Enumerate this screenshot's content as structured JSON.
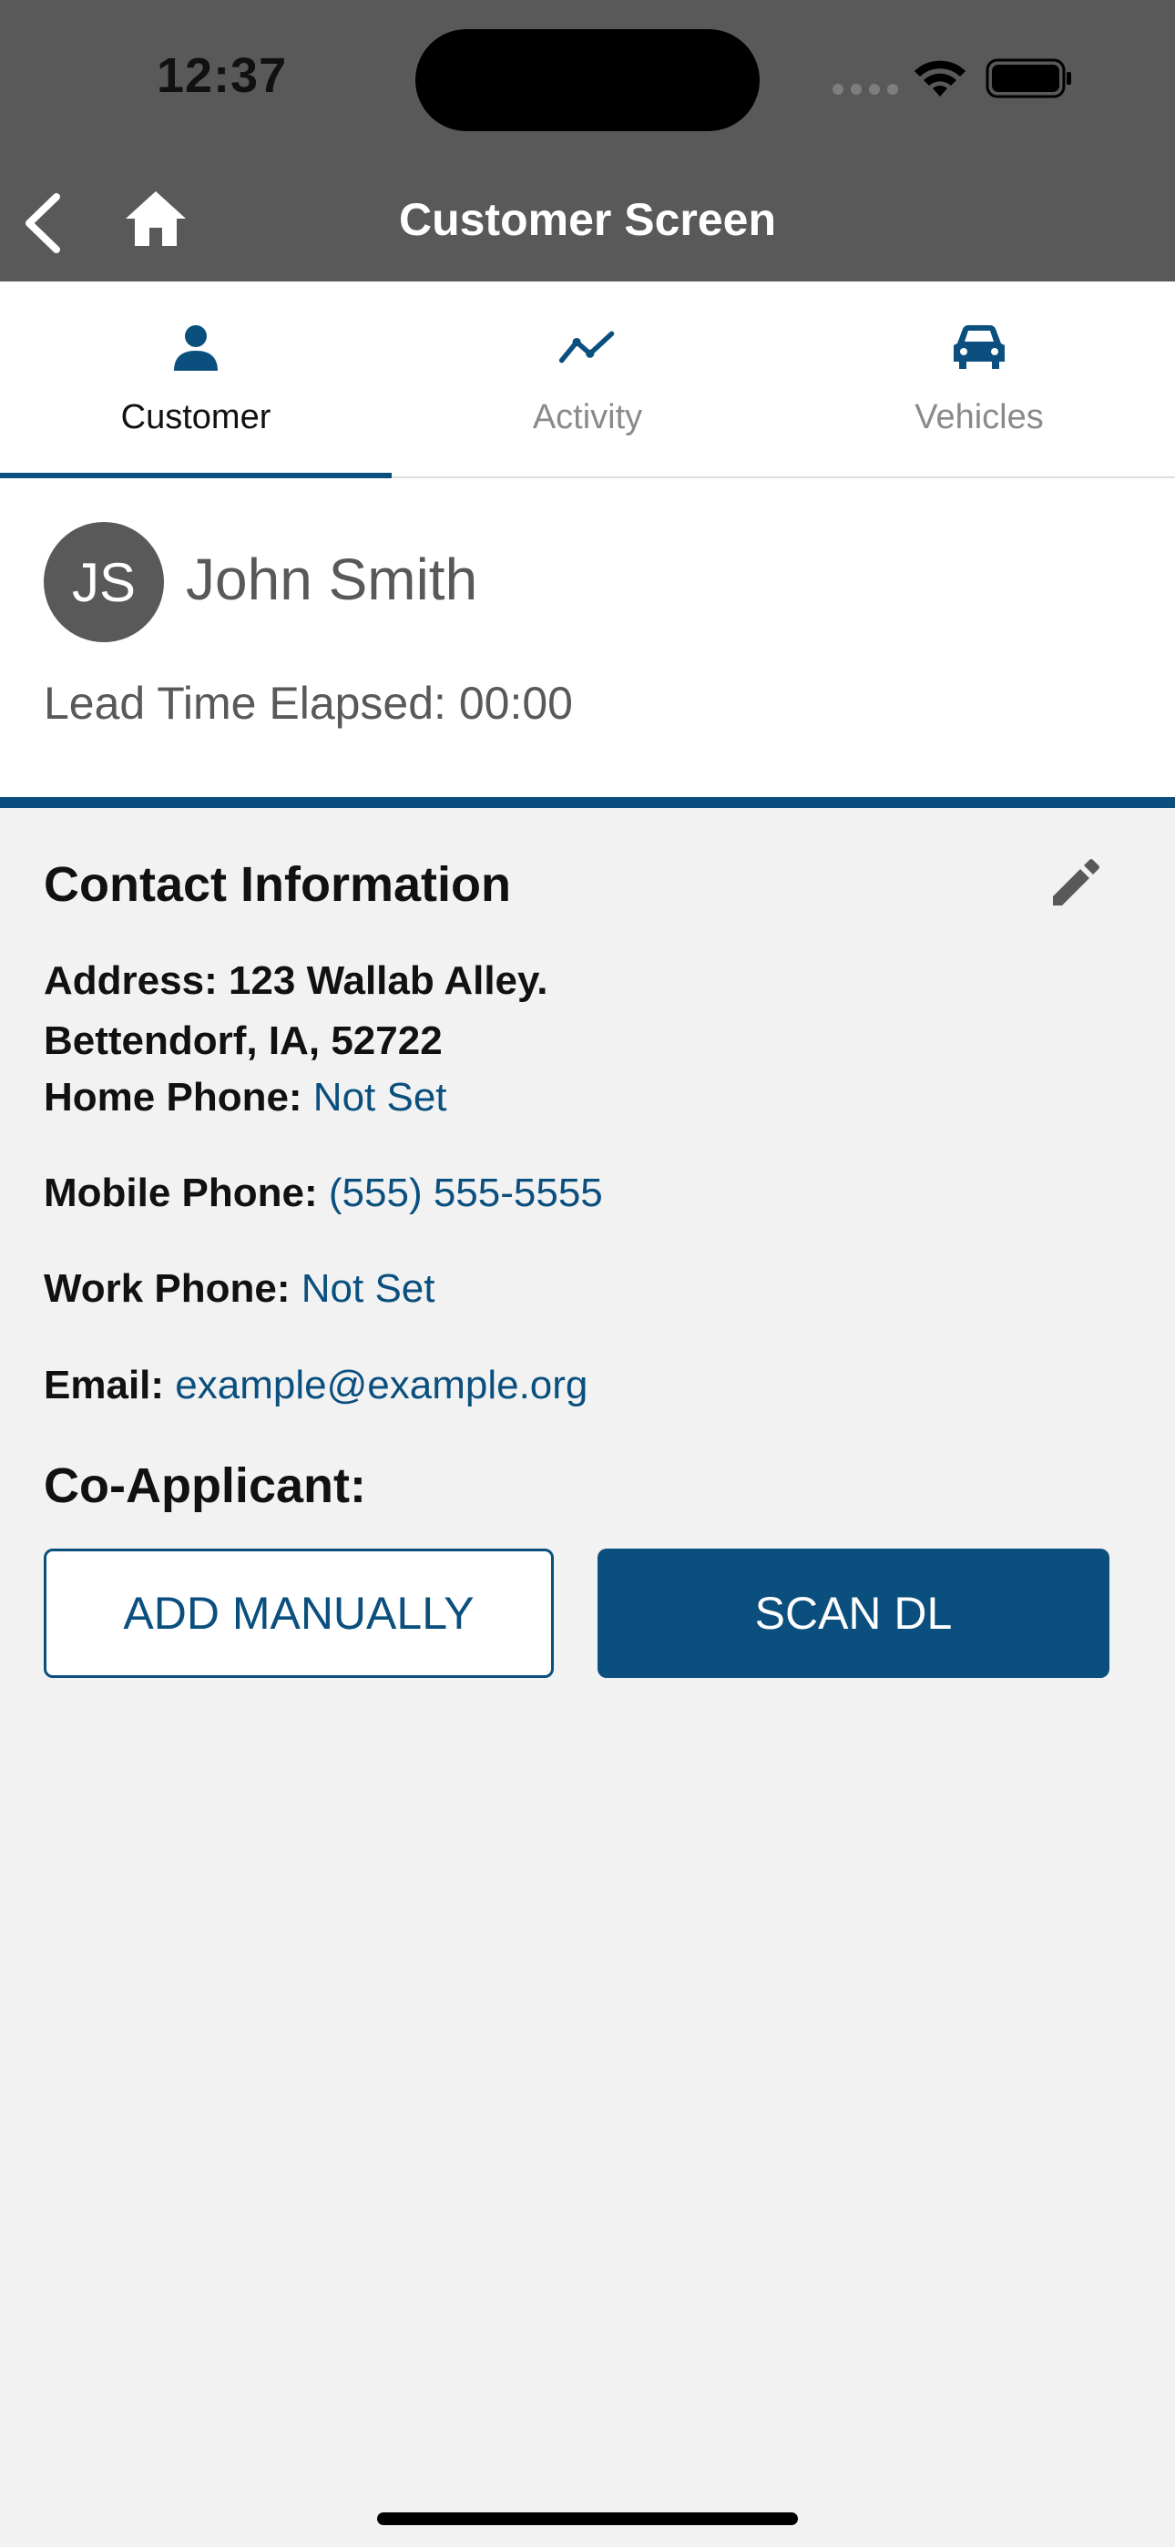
{
  "status_bar": {
    "time": "12:37"
  },
  "header": {
    "title": "Customer Screen",
    "icons": [
      "back-icon",
      "home-icon"
    ]
  },
  "tabs": [
    {
      "label": "Customer",
      "icon": "person-icon",
      "active": true
    },
    {
      "label": "Activity",
      "icon": "activity-chart-icon",
      "active": false
    },
    {
      "label": "Vehicles",
      "icon": "car-icon",
      "active": false
    }
  ],
  "customer": {
    "initials": "JS",
    "name": "John Smith",
    "lead_time": "Lead Time Elapsed: 00:00"
  },
  "contact": {
    "heading": "Contact Information",
    "address_line1": "Address: 123 Wallab Alley.",
    "address_line2": "Bettendorf, IA, 52722",
    "home_phone_label": "Home Phone:",
    "home_phone_value": "Not Set",
    "mobile_phone_label": "Mobile Phone:",
    "mobile_phone_value": "(555) 555-5555",
    "work_phone_label": "Work Phone:",
    "work_phone_value": "Not Set",
    "email_label": "Email:",
    "email_value": "example@example.org"
  },
  "co_applicant": {
    "heading": "Co-Applicant:",
    "add_manually_label": "ADD MANUALLY",
    "scan_dl_label": "SCAN DL"
  },
  "colors": {
    "accent": "#0a4f7e",
    "header_bg": "#595959",
    "page_bg": "#f2f2f2"
  }
}
